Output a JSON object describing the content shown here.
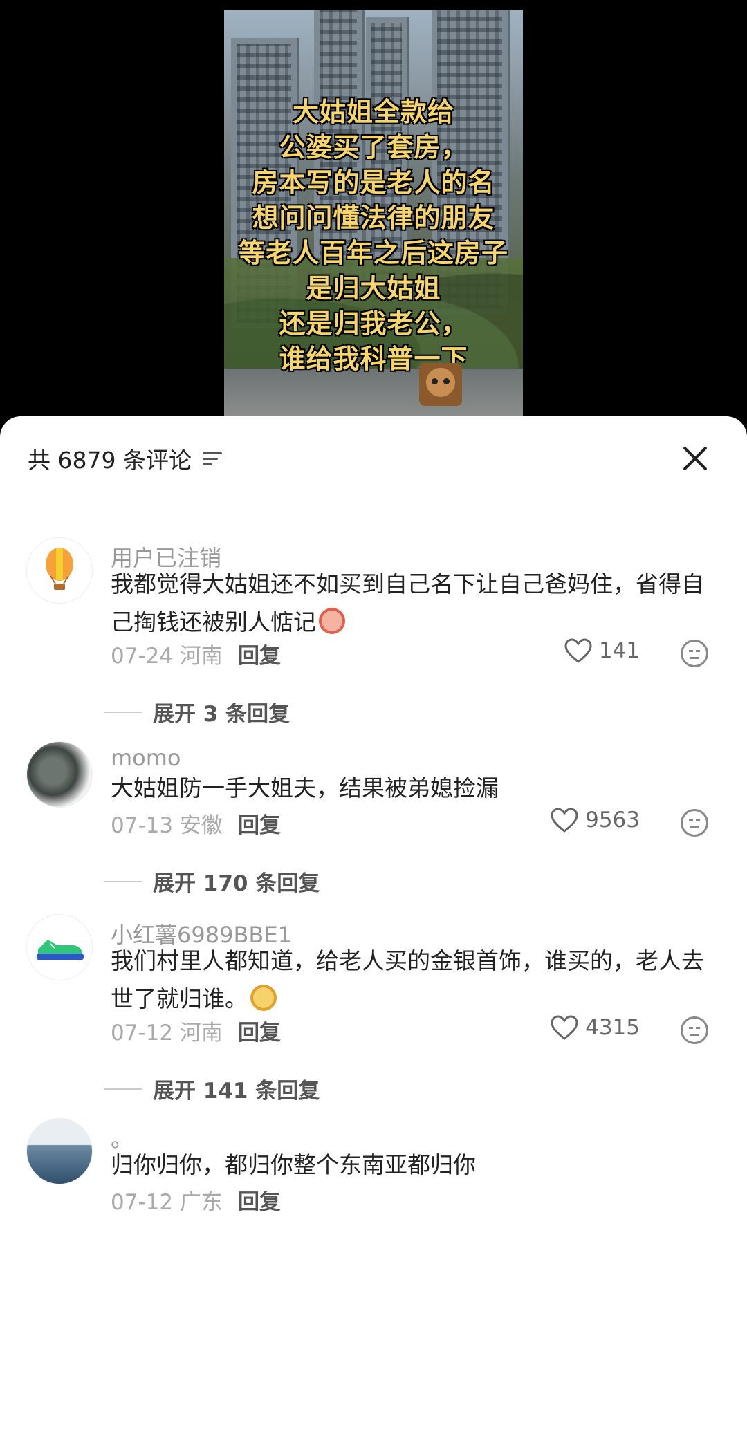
{
  "video": {
    "caption_lines": [
      "大姑姐全款给",
      "公婆买了套房，",
      "房本写的是老人的名",
      "想问问懂法律的朋友",
      "等老人百年之后这房子",
      "是归大姑姐",
      "还是归我老公，",
      "谁给我科普一下"
    ]
  },
  "sheet": {
    "count_label": "共 6879 条评论",
    "sort_icon": "filter-lines-icon",
    "close_icon": "close-icon"
  },
  "comments": [
    {
      "name": "用户已注销",
      "text": "我都觉得大姑姐还不如买到自己名下让自己爸妈住，省得自己掏钱还被别人惦记",
      "date_location": "07-24 河南",
      "reply_label": "回复",
      "likes": "141",
      "expand_label": "展开 3 条回复"
    },
    {
      "name": "momo",
      "text": "大姑姐防一手大姐夫，结果被弟媳捡漏",
      "date_location": "07-13 安徽",
      "reply_label": "回复",
      "likes": "9563",
      "expand_label": "展开 170 条回复"
    },
    {
      "name": "小红薯6989BBE1",
      "text": "我们村里人都知道，给老人买的金银首饰，谁买的，老人去世了就归谁。",
      "date_location": "07-12 河南",
      "reply_label": "回复",
      "likes": "4315",
      "expand_label": "展开 141 条回复"
    },
    {
      "name": "。",
      "text": "归你归你，都归你整个东南亚都归你",
      "date_location": "07-12 广东",
      "reply_label": "回复"
    }
  ],
  "colors": {
    "caption": "#f6d56a",
    "accent": "#222222"
  }
}
